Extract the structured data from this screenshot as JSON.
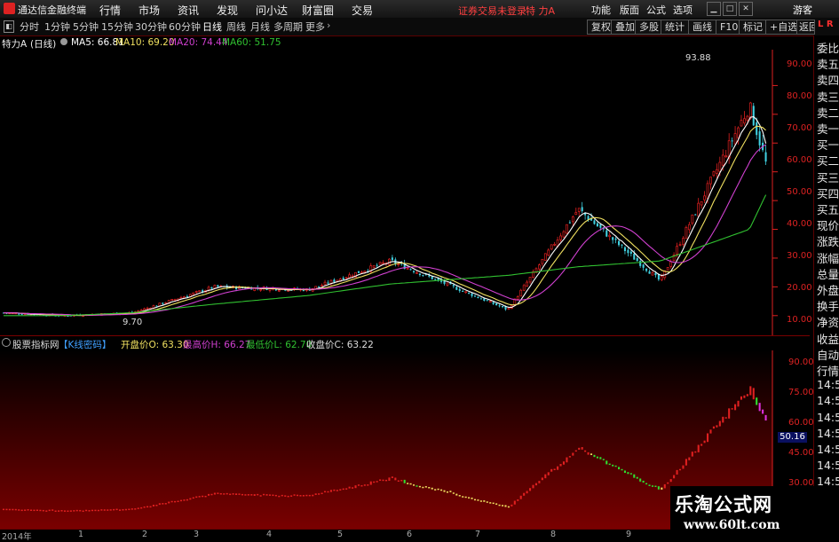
{
  "app": {
    "title": "通达信金融终端",
    "status_text": "证券交易未登录",
    "stock_title": "特 力A",
    "buttons_right": [
      "功能",
      "版面",
      "公式",
      "选项"
    ],
    "guest": "游客"
  },
  "menu": [
    "行情",
    "市场",
    "资讯",
    "发现",
    "问小达",
    "财富圈",
    "交易"
  ],
  "periods": [
    "分时",
    "1分钟",
    "5分钟",
    "15分钟",
    "30分钟",
    "60分钟",
    "日线",
    "周线",
    "月线",
    "多周期",
    "更多"
  ],
  "active_period": "日线",
  "toolbar_right": [
    "复权",
    "叠加",
    "多股",
    "统计",
    "画线",
    "F10",
    "标记",
    "+自选",
    "返回"
  ],
  "main_legend": {
    "name": "特力A",
    "period": "(日线)",
    "ma5": "MA5: 66.81",
    "ma10": "MA10: 69.20",
    "ma20": "MA20: 74.44",
    "ma60": "MA60: 51.75"
  },
  "price_axis": [
    "90.00",
    "80.00",
    "70.00",
    "60.00",
    "50.00",
    "40.00",
    "30.00",
    "20.00",
    "10.00"
  ],
  "annotations": {
    "high": "93.88",
    "low": "9.70"
  },
  "indicator_header": {
    "name": "股票指标网",
    "formula": "【K线密码】",
    "open": "开盘价O: 63.30",
    "high": "最高价H: 66.27",
    "low": "最低价L: 62.70",
    "close": "收盘价C: 63.22"
  },
  "indicator_axis": [
    "90.00",
    "75.00",
    "60.00",
    "45.00",
    "30.00"
  ],
  "indicator_badge": "50.16",
  "x_axis": [
    "2014年",
    "1",
    "2",
    "3",
    "4",
    "5",
    "6",
    "7",
    "8",
    "9"
  ],
  "side_panel": [
    "委比",
    "卖五",
    "卖四",
    "卖三",
    "卖二",
    "卖一",
    "买一",
    "买二",
    "买三",
    "买四",
    "买五",
    "现价",
    "涨跌",
    "涨幅",
    "总量",
    "外盘",
    "换手",
    "净资",
    "收益",
    "自动",
    "行情",
    "14:5",
    "14:5",
    "14:5",
    "14:5",
    "14:5",
    "14:5",
    "14:5",
    "14:5"
  ],
  "side_corner": "L R",
  "watermark": {
    "line1": "乐淘公式网",
    "line2": "www.60lt.com"
  },
  "colors": {
    "up": "#e02020",
    "down": "#40d0e0",
    "ma5": "#ffffff",
    "ma10": "#f0e060",
    "ma20": "#d040d0",
    "ma60": "#30c030",
    "axis": "#dd2020"
  },
  "chart_data": {
    "type": "line",
    "title": "特力A (日线)",
    "ylim": [
      5,
      100
    ],
    "x": [
      "2014年",
      "1",
      "2",
      "3",
      "4",
      "5",
      "6",
      "7",
      "8",
      "9"
    ],
    "series": [
      {
        "name": "Close",
        "values": [
          11,
          10,
          11,
          20,
          19,
          29,
          12,
          47,
          22,
          83,
          63
        ]
      },
      {
        "name": "MA60",
        "values": [
          10,
          10,
          11,
          14,
          17,
          21,
          24,
          27,
          29,
          40,
          52
        ]
      }
    ]
  }
}
